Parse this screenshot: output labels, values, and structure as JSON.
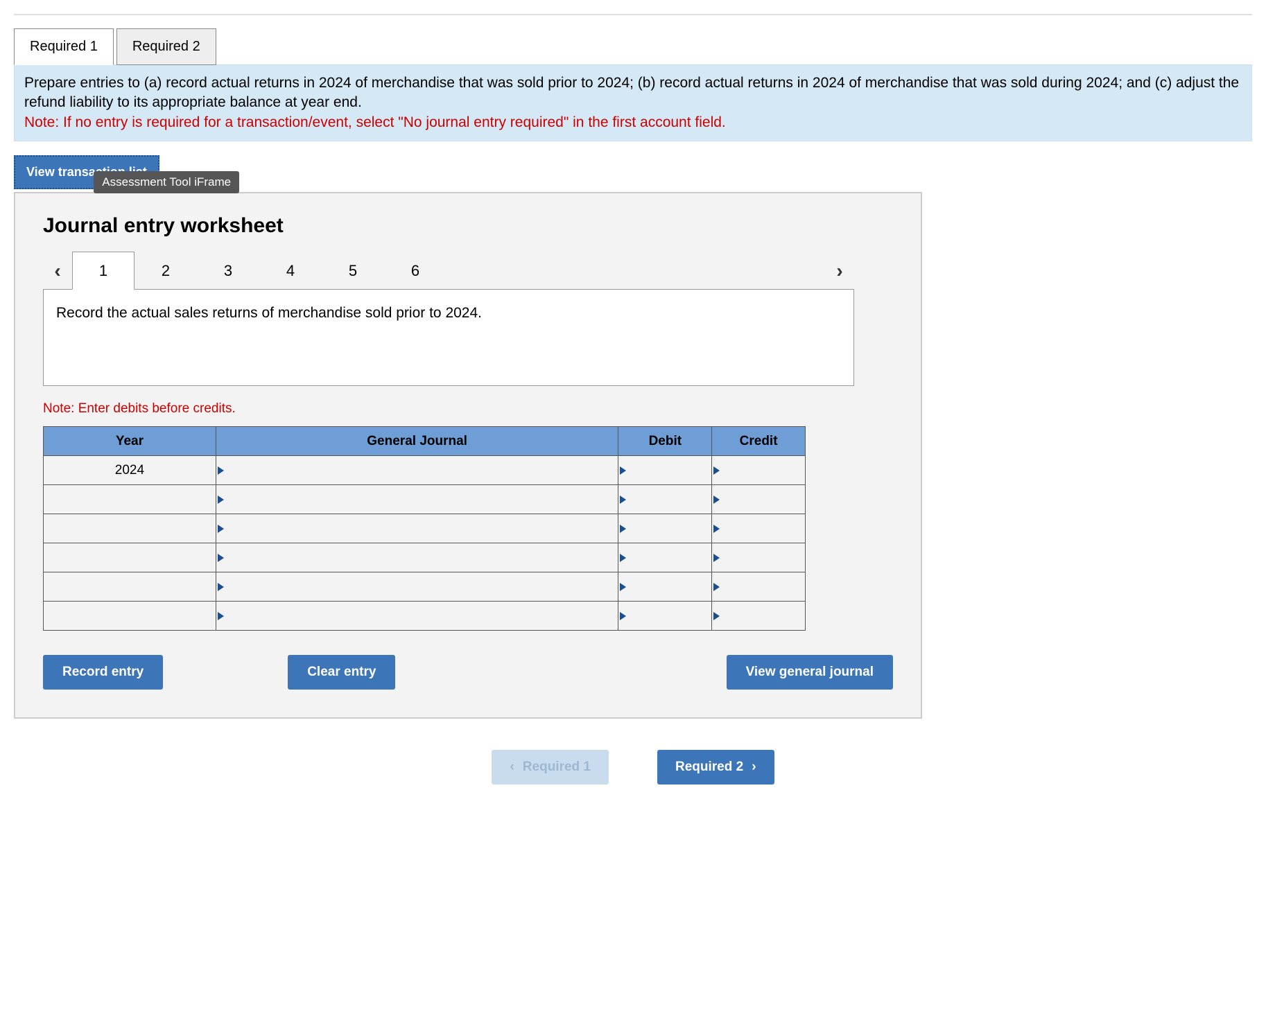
{
  "top_tabs": {
    "t1": "Required 1",
    "t2": "Required 2"
  },
  "instructions": {
    "body": "Prepare entries to (a) record actual returns in 2024 of merchandise that was sold prior to 2024; (b) record actual returns in 2024 of merchandise that was sold during 2024; and (c) adjust the refund liability to its appropriate balance at year end.",
    "note": "Note: If no entry is required for a transaction/event, select \"No journal entry required\" in the first account field."
  },
  "view_trans": "View transaction list",
  "tooltip": "Assessment Tool iFrame",
  "ws_title": "Journal entry worksheet",
  "steps": {
    "s1": "1",
    "s2": "2",
    "s3": "3",
    "s4": "4",
    "s5": "5",
    "s6": "6"
  },
  "prompt": "Record the actual sales returns of merchandise sold prior to 2024.",
  "note2": "Note: Enter debits before credits.",
  "table": {
    "h_year": "Year",
    "h_gj": "General Journal",
    "h_debit": "Debit",
    "h_credit": "Credit",
    "row1_year": "2024"
  },
  "buttons": {
    "record": "Record entry",
    "clear": "Clear entry",
    "view_gj": "View general journal"
  },
  "nav": {
    "prev": "Required 1",
    "next": "Required 2"
  }
}
